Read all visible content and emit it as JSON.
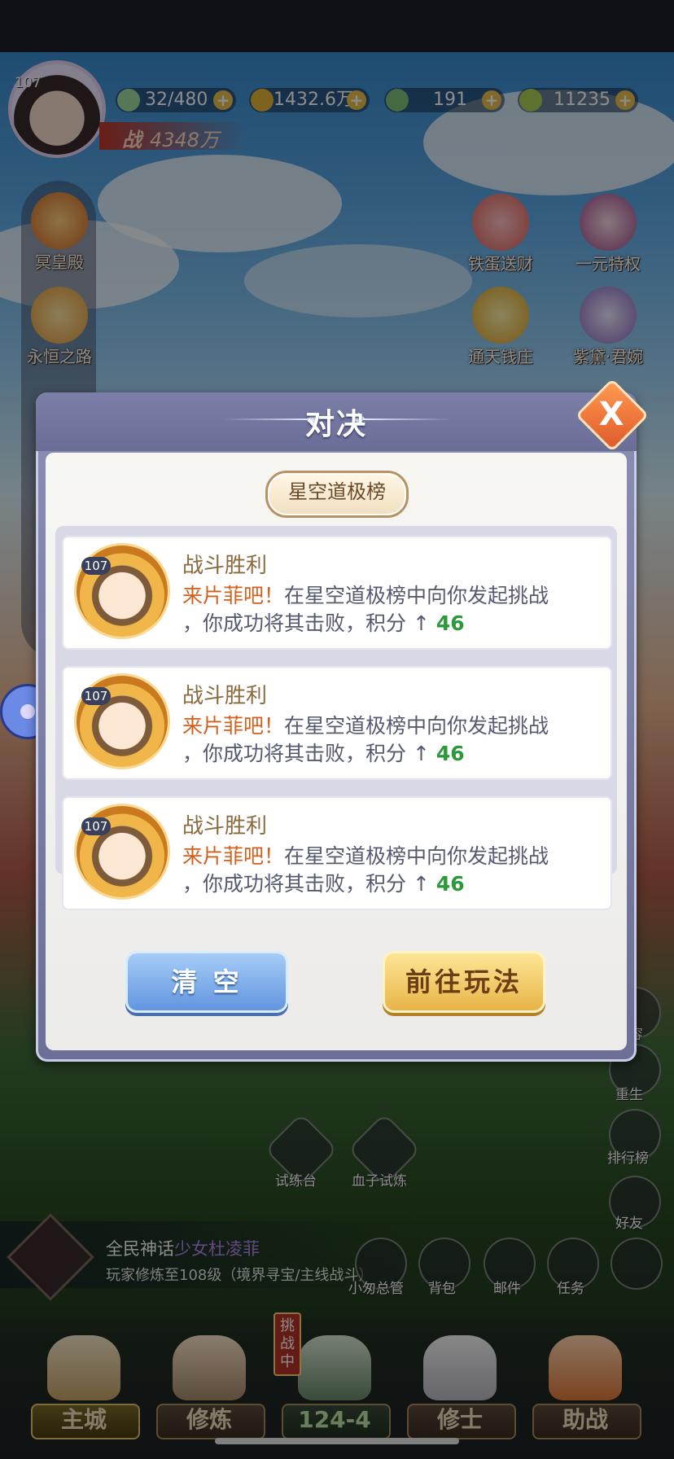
{
  "player": {
    "level": "107",
    "power_label": "战",
    "power_value": "4348万"
  },
  "resources": [
    {
      "icon": "stamina-icon",
      "value": "32/480"
    },
    {
      "icon": "coin-icon",
      "value": "1432.6万"
    },
    {
      "icon": "jade-icon",
      "value": "191"
    },
    {
      "icon": "leaf-icon",
      "value": "11235"
    }
  ],
  "left_menu": [
    {
      "icon": "palace-icon",
      "label": "冥皇殿"
    },
    {
      "icon": "path-icon",
      "label": "永恒之路"
    }
  ],
  "right_menu": [
    {
      "icon": "dragon-icon",
      "label": "铁蛋送财"
    },
    {
      "icon": "privilege-icon",
      "label": "一元特权"
    },
    {
      "icon": "money-pot-icon",
      "label": "通天钱庄"
    },
    {
      "icon": "heroine-icon",
      "label": "紫黛·君婉"
    }
  ],
  "right_round": [
    {
      "icon": "lineup-icon",
      "label": "阵容"
    },
    {
      "icon": "rebirth-icon",
      "label": "重生"
    },
    {
      "icon": "rank-icon",
      "label": "排行榜"
    },
    {
      "icon": "friends-icon",
      "label": "好友"
    }
  ],
  "scene_buttons": [
    {
      "icon": "trial-icon",
      "label": "试练台"
    },
    {
      "icon": "blood-icon",
      "label": "血子试炼"
    }
  ],
  "news": {
    "prefix": "全民神话",
    "highlight": "少女杜凌菲",
    "detail": "玩家修炼至108级（境界寻宝/主线战斗）"
  },
  "bottom_round": [
    {
      "icon": "manager-icon",
      "label": "小匆总管"
    },
    {
      "icon": "bag-icon",
      "label": "背包"
    },
    {
      "icon": "mail-icon",
      "label": "邮件"
    },
    {
      "icon": "task-icon",
      "label": "任务"
    },
    {
      "icon": "fan-icon",
      "label": ""
    }
  ],
  "nav": [
    {
      "label": "主城"
    },
    {
      "label": "修炼"
    },
    {
      "label": "124-4",
      "badge": "挑战中"
    },
    {
      "label": "修士"
    },
    {
      "label": "助战"
    }
  ],
  "dialog": {
    "title": "对决",
    "tag": "星空道极榜",
    "close_symbol": "X",
    "entries": [
      {
        "level": "107",
        "title": "战斗胜利",
        "name": "来片菲吧！",
        "text1": "在星空道极榜中向你发起挑战",
        "text2": "，你成功将其击败，积分",
        "arrow": "↑",
        "points": "46"
      },
      {
        "level": "107",
        "title": "战斗胜利",
        "name": "来片菲吧！",
        "text1": "在星空道极榜中向你发起挑战",
        "text2": "，你成功将其击败，积分",
        "arrow": "↑",
        "points": "46"
      },
      {
        "level": "107",
        "title": "战斗胜利",
        "name": "来片菲吧！",
        "text1": "在星空道极榜中向你发起挑战",
        "text2": "，你成功将其击败，积分",
        "arrow": "↑",
        "points": "46"
      }
    ],
    "clear_button": "清 空",
    "go_button": "前往玩法"
  }
}
